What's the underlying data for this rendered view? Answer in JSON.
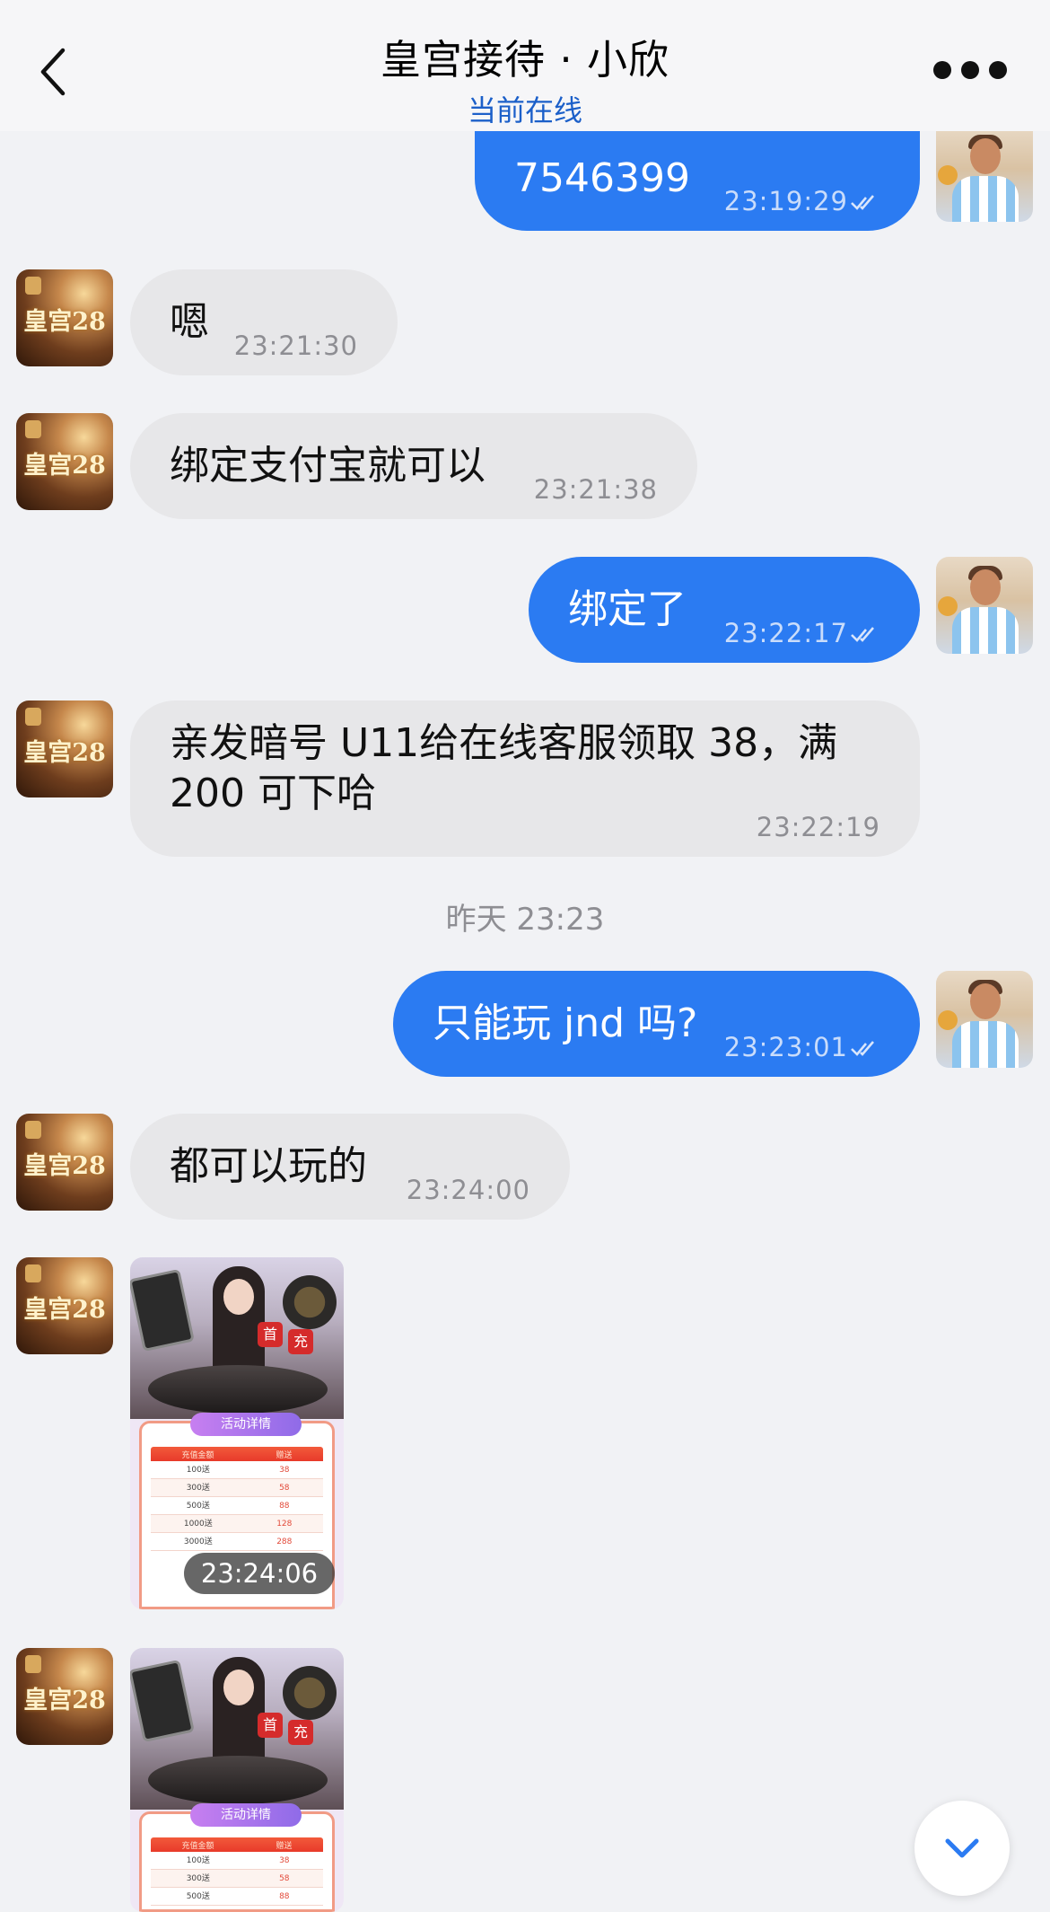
{
  "header": {
    "title": "皇宫接待 · 小欣",
    "status": "当前在线"
  },
  "messages": [
    {
      "text": "7546399",
      "time": "23:19:29"
    },
    {
      "text": "嗯",
      "time": "23:21:30"
    },
    {
      "text": "绑定支付宝就可以",
      "time": "23:21:38"
    },
    {
      "text": "绑定了",
      "time": "23:22:17"
    },
    {
      "text": "亲发暗号 U11给在线客服领取 38，满 200 可下哈",
      "time": "23:22:19"
    },
    {
      "text": "只能玩 jnd 吗?",
      "time": "23:23:01"
    },
    {
      "text": "都可以玩的",
      "time": "23:24:00"
    }
  ],
  "date_divider": "昨天 23:23",
  "images": [
    {
      "time": "23:24:06"
    },
    {
      "time": ""
    }
  ],
  "avatar_agent_text": "皇宫28",
  "promo": {
    "panel_title": "活动详情",
    "badge_1": "首",
    "badge_2": "充",
    "table_header": [
      "充值金额",
      "赠送"
    ],
    "rows": [
      [
        "100送",
        "38"
      ],
      [
        "300送",
        "58"
      ],
      [
        "500送",
        "88"
      ],
      [
        "1000送",
        "128"
      ],
      [
        "3000送",
        "288"
      ]
    ]
  },
  "colors": {
    "outgoing_bubble": "#2b7bf2",
    "incoming_bubble": "#e7e7e9",
    "status_text": "#1b5fc9",
    "background": "#f1f2f5"
  },
  "icons": {
    "back": "chevron-left-icon",
    "more": "more-dots-icon",
    "read": "double-check-icon",
    "scroll": "chevron-down-icon"
  }
}
